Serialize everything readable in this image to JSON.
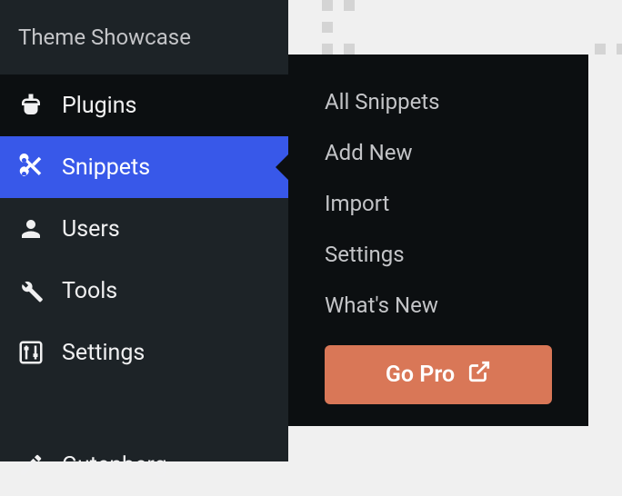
{
  "sidebar": {
    "header": "Theme Showcase",
    "items": [
      {
        "label": "Plugins",
        "icon": "plugins"
      },
      {
        "label": "Snippets",
        "icon": "scissors",
        "active": true
      },
      {
        "label": "Users",
        "icon": "user"
      },
      {
        "label": "Tools",
        "icon": "wrench"
      },
      {
        "label": "Settings",
        "icon": "sliders"
      }
    ],
    "gutenberg": {
      "label": "Gutenberg",
      "icon": "pencil"
    }
  },
  "submenu": {
    "items": [
      "All Snippets",
      "Add New",
      "Import",
      "Settings",
      "What's New"
    ],
    "cta": "Go Pro"
  }
}
